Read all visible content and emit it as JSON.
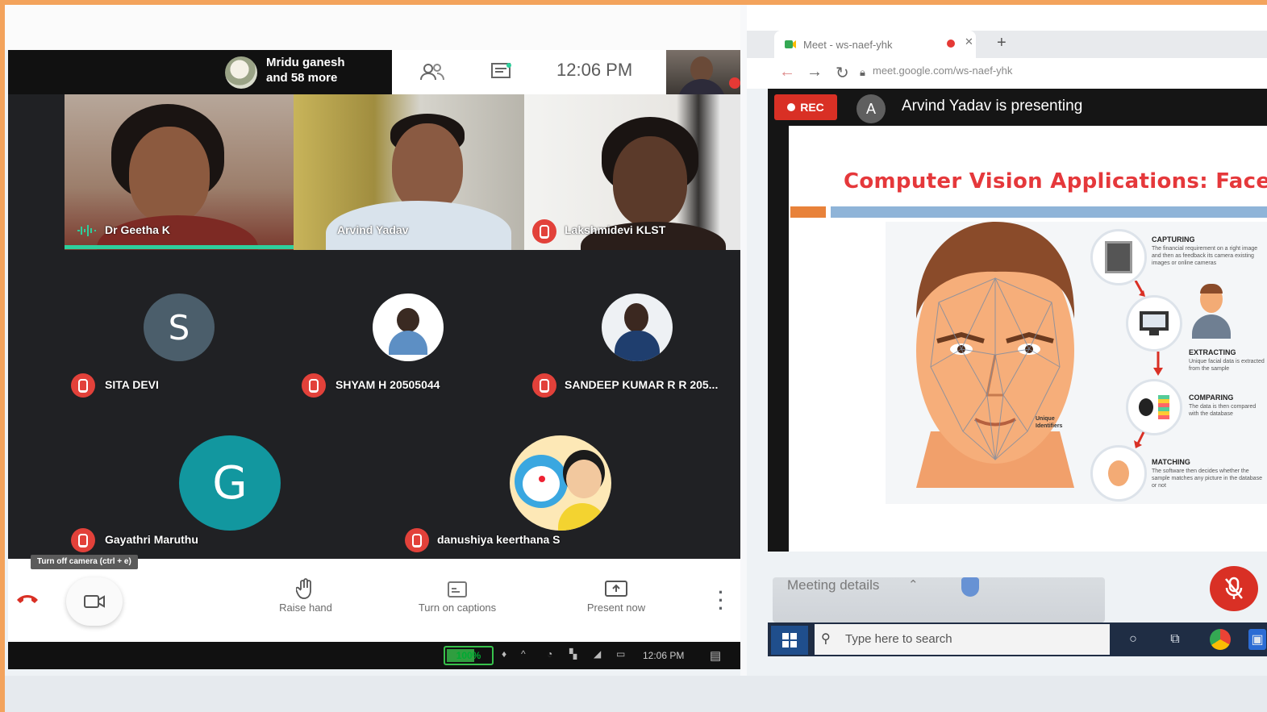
{
  "meet": {
    "header": {
      "people_text_line1": "Mridu ganesh",
      "people_text_line2": "and 58 more",
      "time": "12:06 PM",
      "people_icon": "people-icon",
      "chat_icon": "chat-icon"
    },
    "video_tiles": [
      {
        "name": "Dr Geetha K",
        "speaking": true
      },
      {
        "name": "Arvind Yadav",
        "muted": false
      },
      {
        "name": "Lakshmidevi KLST",
        "muted": true
      }
    ],
    "avatar_tiles": [
      {
        "name": "SITA DEVI",
        "initial": "S",
        "color": "#4b5e6b"
      },
      {
        "name": "SHYAM H 20505044",
        "initial": "",
        "color": "#ffffff"
      },
      {
        "name": "SANDEEP KUMAR R R 205...",
        "initial": "",
        "color": "#ffffff"
      },
      {
        "name": "Gayathri Maruthu",
        "initial": "G",
        "color": "#12979f"
      },
      {
        "name": "danushiya keerthana S",
        "initial": "",
        "color": "#ffffff"
      }
    ],
    "controls": {
      "tooltip": "Turn off camera (ctrl + e)",
      "raise_hand": "Raise hand",
      "captions": "Turn on captions",
      "present": "Present now"
    },
    "taskbar": {
      "battery": "100%",
      "time": "12:06 PM"
    }
  },
  "browser": {
    "tab_title": "Meet - ws-naef-yhk",
    "url": "meet.google.com/ws-naef-yhk",
    "rec_label": "REC",
    "presenter_initial": "A",
    "presenting_text": "Arvind Yadav is presenting",
    "slide": {
      "title": "Computer Vision Applications: Face Rec",
      "steps": [
        {
          "label": "CAPTURING",
          "desc": "The financial requirement on a right image and then as feedback its camera existing images or online cameras"
        },
        {
          "label": "EXTRACTING",
          "desc": "Unique facial data is extracted from the sample"
        },
        {
          "label": "COMPARING",
          "desc": "The data is then compared with the database"
        },
        {
          "label": "MATCHING",
          "desc": "The software then decides whether the sample matches any picture in the database or not"
        }
      ],
      "face_note": "Unique Identifiers"
    },
    "meeting_details": "Meeting details",
    "taskbar_search": "Type here to search"
  },
  "colors": {
    "frame_border": "#f3a35c",
    "meet_dark": "#202124",
    "mute_red": "#e2413a",
    "speaking_green": "#2ecf9c",
    "slide_title_red": "#e5383b"
  }
}
